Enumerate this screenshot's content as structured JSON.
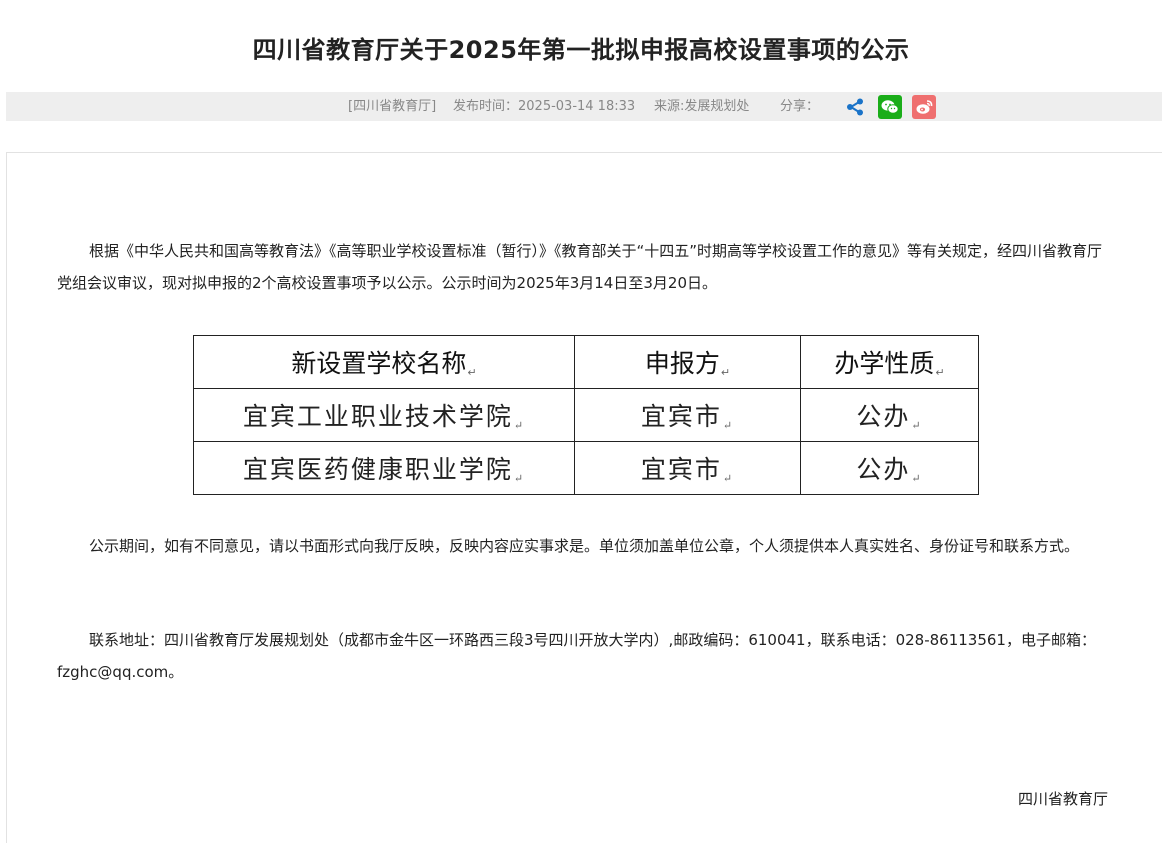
{
  "title": "四川省教育厅关于2025年第一批拟申报高校设置事项的公示",
  "meta": {
    "source_tag": "[四川省教育厅]",
    "publish_time": "发布时间：2025-03-14 18:33",
    "origin": "来源:发展规划处",
    "share_label": "分享："
  },
  "share_icons": [
    "share-icon",
    "wechat-icon",
    "weibo-icon"
  ],
  "colors": {
    "wechat": "#1aad19",
    "weibo": "#ef6f6f",
    "share": "#1a73c8"
  },
  "body": {
    "para1": "根据《中华人民共和国高等教育法》《高等职业学校设置标准（暂行）》《教育部关于“十四五”时期高等学校设置工作的意见》等有关规定，经四川省教育厅党组会议审议，现对拟申报的2个高校设置事项予以公示。公示时间为2025年3月14日至3月20日。",
    "para2": "公示期间，如有不同意见，请以书面形式向我厅反映，反映内容应实事求是。单位须加盖单位公章，个人须提供本人真实姓名、身份证号和联系方式。",
    "para3": "联系地址：四川省教育厅发展规划处（成都市金牛区一环路西三段3号四川开放大学内）,邮政编码：610041，联系电话：028-86113561，电子邮箱：fzghc@qq.com。"
  },
  "table": {
    "headers": [
      "新设置学校名称",
      "申报方",
      "办学性质"
    ],
    "rows": [
      [
        "宜宾工业职业技术学院",
        "宜宾市",
        "公办"
      ],
      [
        "宜宾医药健康职业学院",
        "宜宾市",
        "公办"
      ]
    ],
    "paragraph_mark": "↵"
  },
  "signature": "四川省教育厅"
}
